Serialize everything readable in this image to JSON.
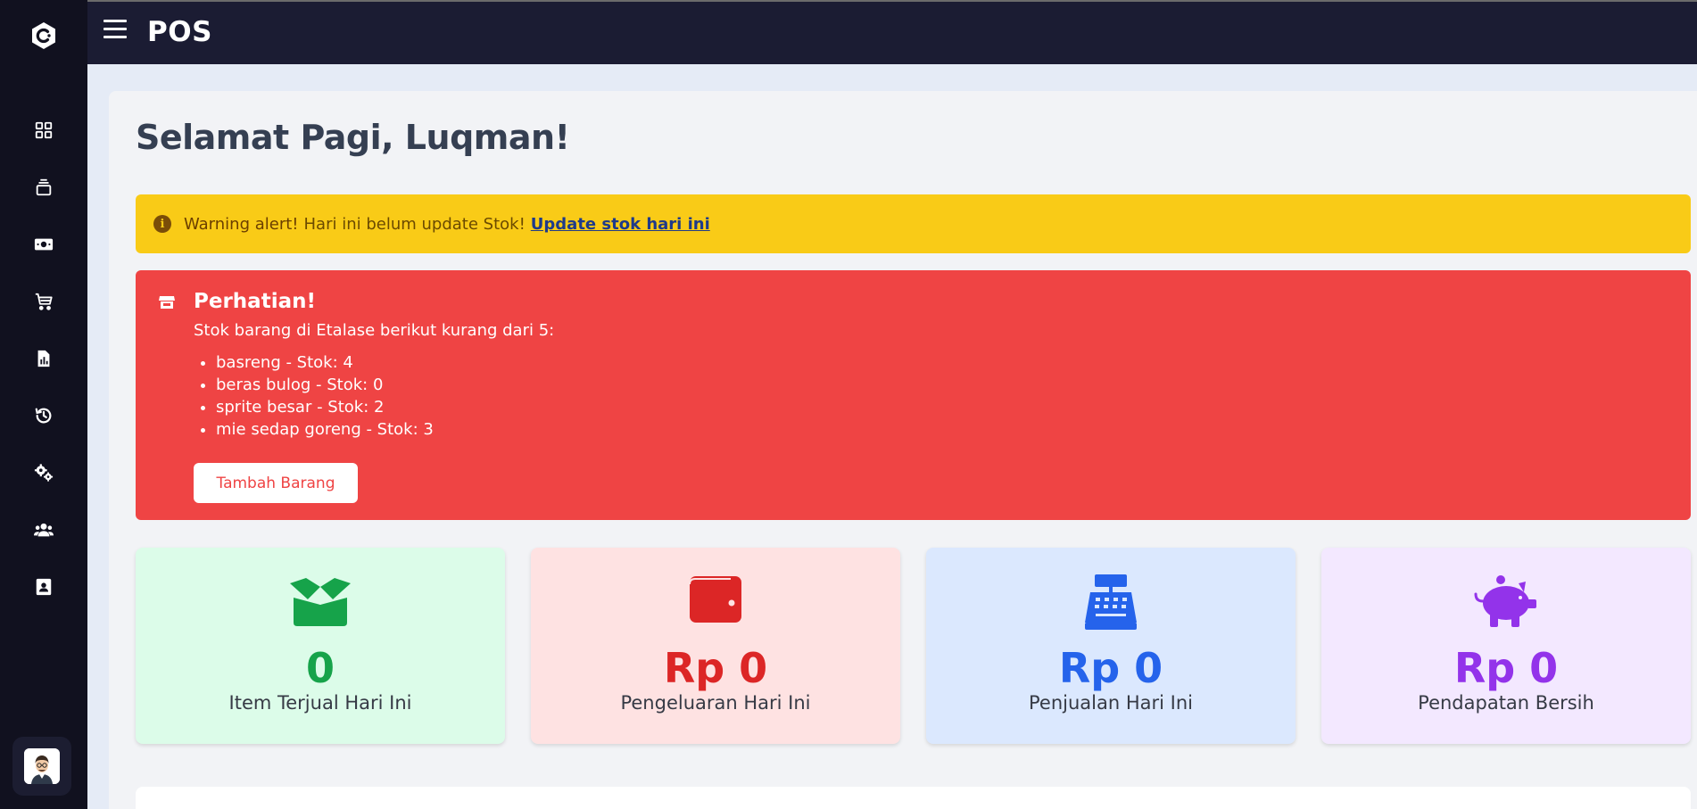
{
  "header": {
    "app_title": "POS"
  },
  "sidebar": {
    "items": [
      {
        "icon": "dashboard-grid-icon"
      },
      {
        "icon": "layers-icon"
      },
      {
        "icon": "money-icon"
      },
      {
        "icon": "cart-icon"
      },
      {
        "icon": "report-file-icon"
      },
      {
        "icon": "history-icon"
      },
      {
        "icon": "settings-gears-icon"
      },
      {
        "icon": "users-icon"
      },
      {
        "icon": "contact-card-icon"
      }
    ]
  },
  "main": {
    "greeting": "Selamat Pagi, Luqman!",
    "warning": {
      "strong": "Warning alert!",
      "text": "Hari ini belum update Stok!",
      "link": "Update stok hari ini"
    },
    "alert": {
      "title": "Perhatian!",
      "subtitle": "Stok barang di Etalase berikut kurang dari 5:",
      "items": [
        "basreng - Stok: 4",
        "beras bulog - Stok: 0",
        "sprite besar - Stok: 2",
        "mie sedap goreng - Stok: 3"
      ],
      "button": "Tambah Barang"
    },
    "cards": [
      {
        "value": "0",
        "label": "Item Terjual Hari Ini",
        "color": "#16a34a"
      },
      {
        "value": "Rp 0",
        "label": "Pengeluaran Hari Ini",
        "color": "#dc2626"
      },
      {
        "value": "Rp 0",
        "label": "Penjualan Hari Ini",
        "color": "#2563eb"
      },
      {
        "value": "Rp 0",
        "label": "Pendapatan Bersih",
        "color": "#9333ea"
      }
    ]
  },
  "colors": {
    "sidebar_bg": "#11111f",
    "topbar_bg": "#1b1c33",
    "warning_bg": "#f9cb17",
    "danger_bg": "#ef4444"
  }
}
